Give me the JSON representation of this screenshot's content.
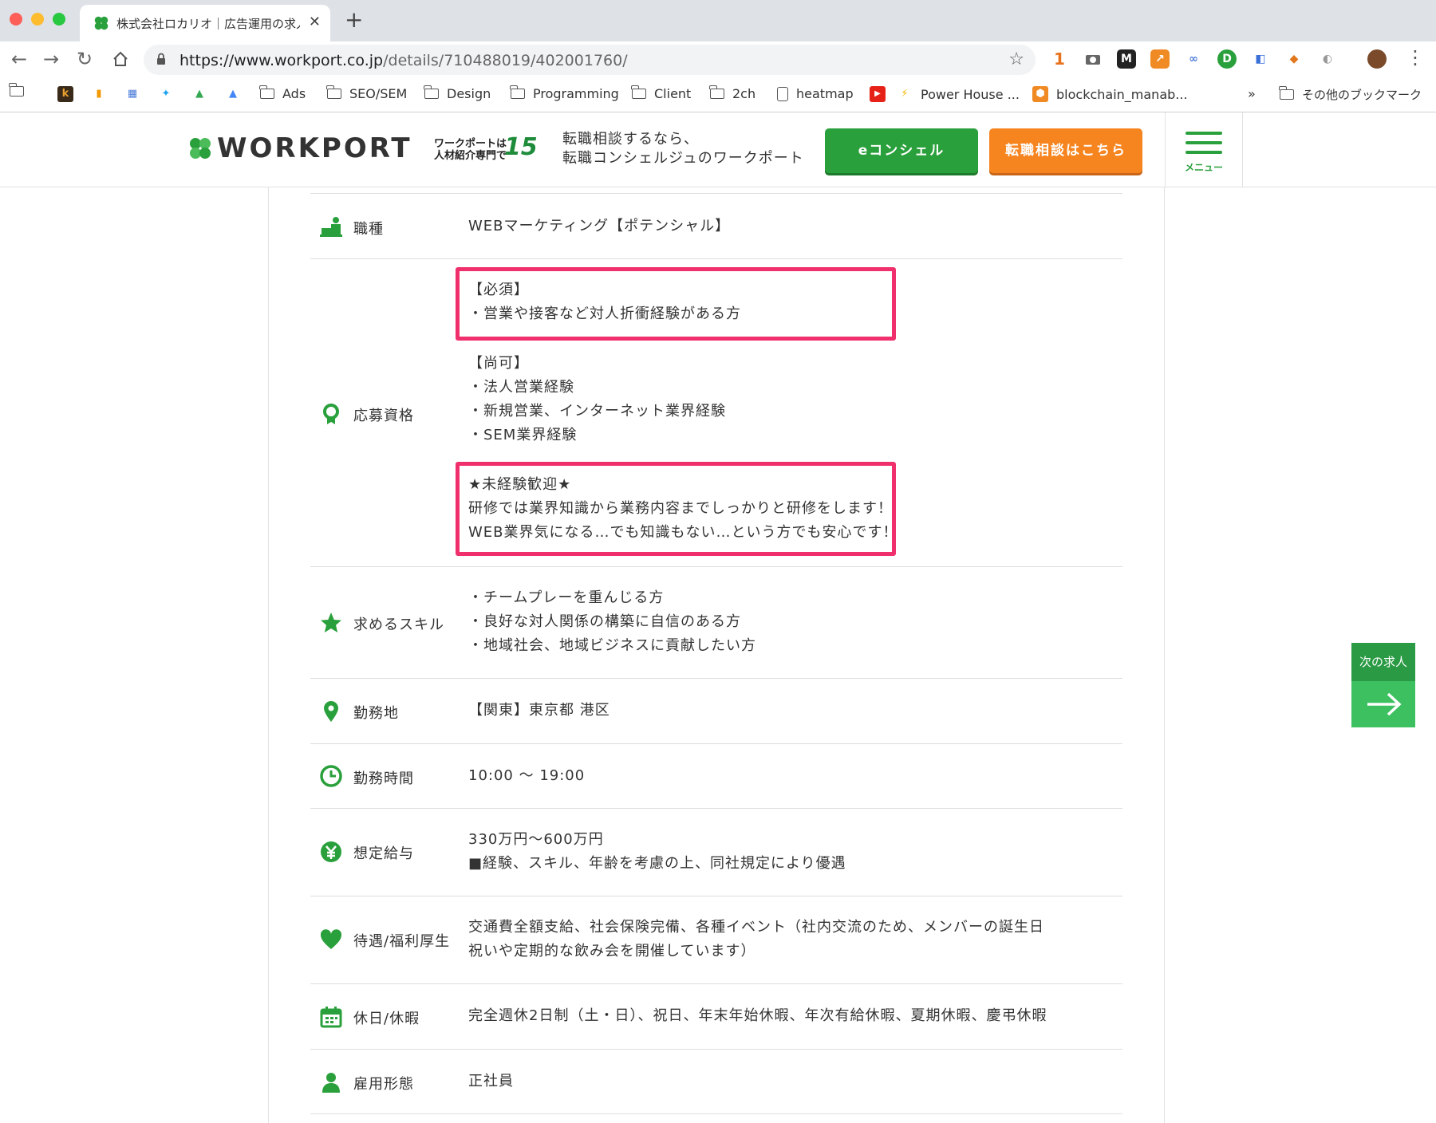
{
  "browser": {
    "tab_title": "株式会社ロカリオ｜広告運用の求人",
    "new_tab": "+",
    "close": "✕",
    "url_host": "https://www.workport.co.jp",
    "url_path": "/details/710488019/402001760/",
    "toolbar_badge_number": "1",
    "bookmarks": {
      "ads": "Ads",
      "seo": "SEO/SEM",
      "design": "Design",
      "programming": "Programming",
      "client": "Client",
      "twoch": "2ch",
      "heatmap": "heatmap",
      "powerhouse": "Power House ...",
      "blockchain": "blockchain_manab...",
      "more": "»",
      "other": "その他のブックマーク"
    }
  },
  "header": {
    "logo_text": "WORKPORT",
    "badge_small_line1": "ワークポートは",
    "badge_small_line2": "人材紹介専門で",
    "badge_big": "15",
    "tagline_line1": "転職相談するなら、",
    "tagline_line2": "転職コンシェルジュのワークポート",
    "concierge_label": "eコンシェル",
    "consult_label": "転職相談はこちら",
    "menu_label": "メニュー"
  },
  "job": {
    "occupation": {
      "label": "職種",
      "value": "WEBマーケティング【ポテンシャル】"
    },
    "qualification": {
      "label": "応募資格",
      "required_heading": "【必須】",
      "required_item": "・営業や接客など対人折衝経験がある方",
      "preferred_heading": "【尚可】",
      "preferred_items": [
        "・法人営業経験",
        "・新規営業、インターネット業界経験",
        "・SEM業界経験"
      ],
      "welcome_heading": "★未経験歓迎★",
      "welcome_line1": "研修では業界知識から業務内容までしっかりと研修をします！",
      "welcome_line2": "WEB業界気になる…でも知識もない…という方でも安心です！"
    },
    "skills": {
      "label": "求めるスキル",
      "items": [
        "・チームプレーを重んじる方",
        "・良好な対人関係の構築に自信のある方",
        "・地域社会、地域ビジネスに貢献したい方"
      ]
    },
    "location": {
      "label": "勤務地",
      "value": "【関東】東京都 港区"
    },
    "hours": {
      "label": "勤務時間",
      "value": "10:00 〜 19:00"
    },
    "salary": {
      "label": "想定給与",
      "line1": "330万円〜600万円",
      "line2": "■経験、スキル、年齢を考慮の上、同社規定により優遇"
    },
    "benefits": {
      "label": "待遇/福利厚生",
      "line1": "交通費全額支給、社会保険完備、各種イベント（社内交流のため、メンバーの誕生日",
      "line2": "祝いや定期的な飲み会を開催しています）"
    },
    "holidays": {
      "label": "休日/休暇",
      "value": "完全週休2日制（土・日）、祝日、年末年始休暇、年次有給休暇、夏期休暇、慶弔休暇"
    },
    "employment": {
      "label": "雇用形態",
      "value": "正社員"
    }
  },
  "next_job": {
    "label": "次の求人"
  },
  "colors": {
    "brand_green": "#2aa03c",
    "orange": "#f6841f",
    "highlight_pink": "#f0306c"
  }
}
